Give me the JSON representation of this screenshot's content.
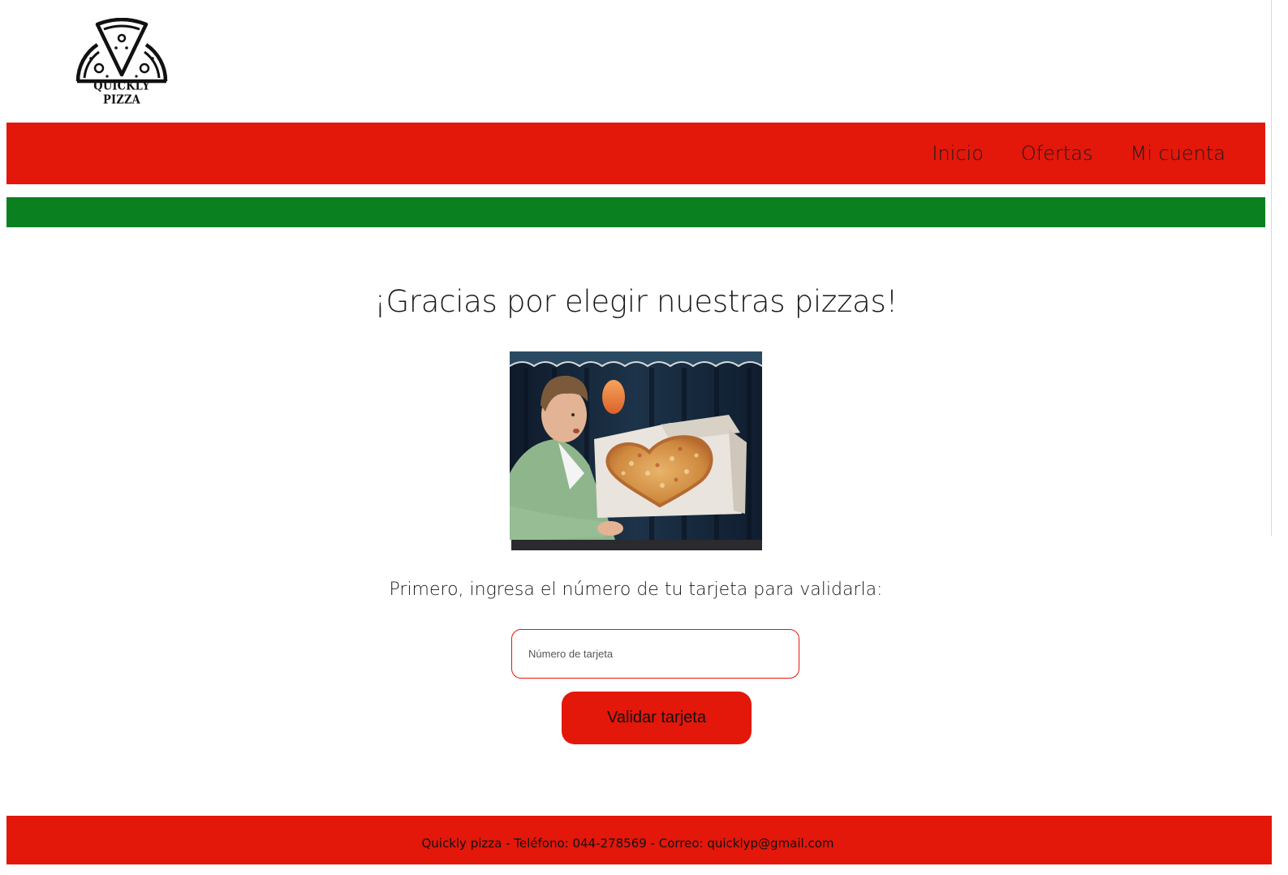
{
  "brand": {
    "logo_text": "QUICKLY PIZZA",
    "logo_icon": "pizza-slice-icon"
  },
  "nav": {
    "items": [
      {
        "label": "Inicio"
      },
      {
        "label": "Ofertas"
      },
      {
        "label": "Mi cuenta"
      }
    ]
  },
  "main": {
    "heading": "¡Gracias por elegir nuestras pizzas!",
    "image_alt": "",
    "instructions": "Primero, ingresa el número de tu tarjeta para validarla:",
    "card_input": {
      "value": "",
      "placeholder": "Número de tarjeta"
    },
    "validate_button": "Validar tarjeta"
  },
  "footer": {
    "text": "Quickly pizza - Teléfono: 044-278569 - Correo: quicklyp@gmail.com"
  },
  "colors": {
    "primary_red": "#e3170a",
    "secondary_green": "#0b8020",
    "background": "#ffffff"
  }
}
